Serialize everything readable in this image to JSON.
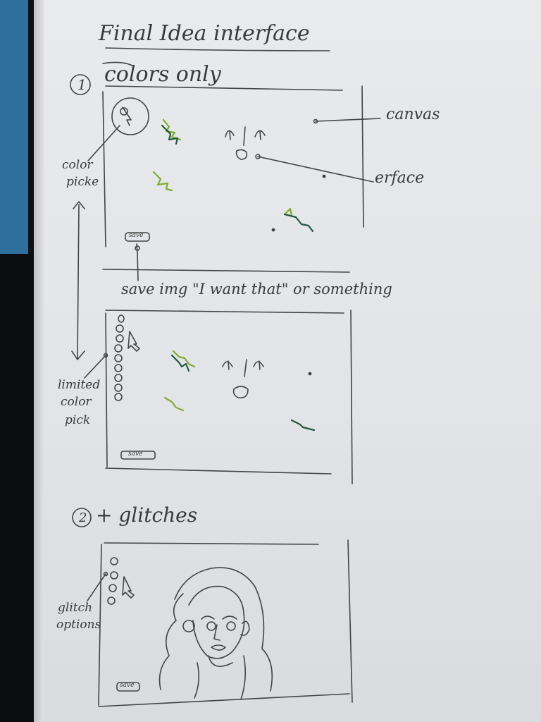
{
  "title": "Final Idea interface",
  "section1": {
    "number": "1",
    "heading": "colors only",
    "labels": {
      "canvas": "canvas",
      "interface": "erface",
      "color_picker": [
        "color",
        "picke"
      ],
      "save_note": "save img \"I want that\" or something",
      "save_button": "save",
      "limited_color_pick": [
        "limited",
        "color",
        "pick"
      ]
    }
  },
  "section2": {
    "number": "2",
    "heading": "+ glitches",
    "labels": {
      "glitch_options": [
        "glitch",
        "options"
      ],
      "save_button": "save"
    }
  },
  "colors": {
    "pencil": "#3a3a3a",
    "green_light": "#7fae2e",
    "green_dark": "#1f5a3a",
    "page": "#e6e7e9",
    "binder": "#2f6f9e"
  }
}
